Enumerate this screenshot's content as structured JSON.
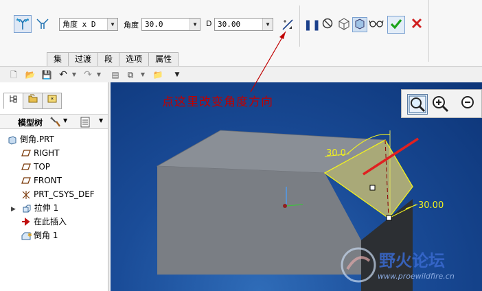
{
  "dashboard": {
    "type_select": "角度 x D",
    "angle_label": "角度",
    "angle_value": "30.0",
    "d_label": "D",
    "d_value": "30.00",
    "tabs": [
      "集",
      "过渡",
      "段",
      "选项",
      "属性"
    ]
  },
  "model_tree": {
    "header_label": "模型树",
    "items": [
      {
        "label": "倒角.PRT",
        "icon": "part-icon"
      },
      {
        "label": "RIGHT",
        "icon": "datum-plane-icon"
      },
      {
        "label": "TOP",
        "icon": "datum-plane-icon"
      },
      {
        "label": "FRONT",
        "icon": "datum-plane-icon"
      },
      {
        "label": "PRT_CSYS_DEF",
        "icon": "csys-icon"
      },
      {
        "label": "拉伸 1",
        "icon": "extrude-icon"
      },
      {
        "label": "在此插入",
        "icon": "insert-arrow-icon"
      },
      {
        "label": "倒角 1",
        "icon": "chamfer-icon"
      }
    ]
  },
  "viewport": {
    "dim_angle": "30.0",
    "dim_d": "30.00"
  },
  "annotation": "点这里改变角度方向",
  "watermark": {
    "title": "野火论坛",
    "url": "www.proewildfire.cn"
  },
  "colors": {
    "accept": "#1aa31a",
    "cancel": "#d02020",
    "annotation": "#c00000",
    "dimension": "#f0f020",
    "chamfer_face": "#a9a978"
  }
}
